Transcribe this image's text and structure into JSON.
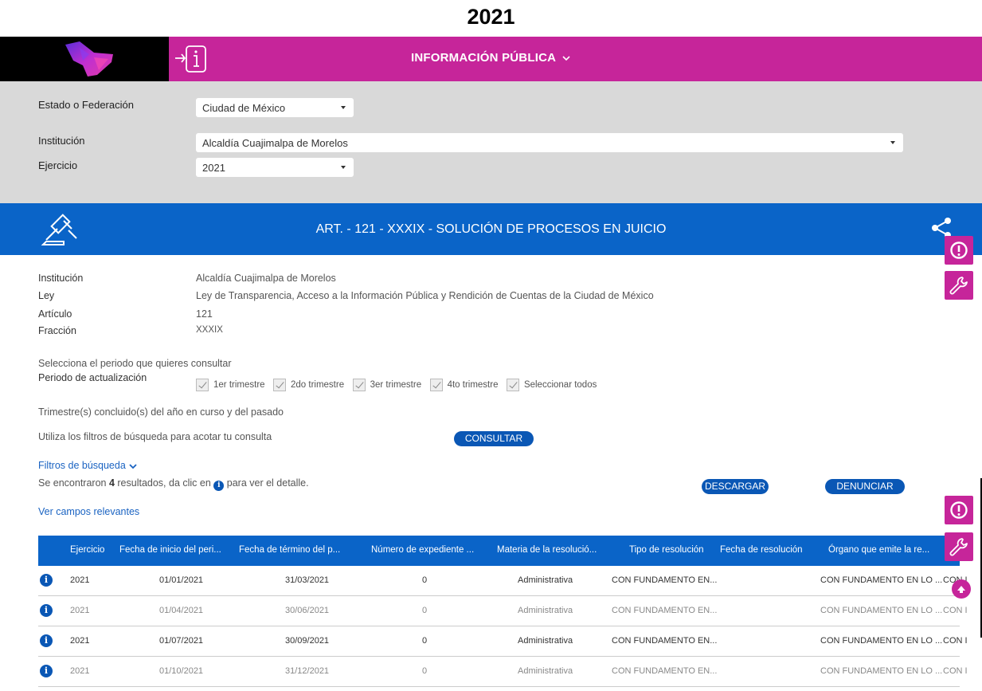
{
  "year_heading": "2021",
  "topbar": {
    "title": "INFORMACIÓN PÚBLICA",
    "colors": {
      "magenta": "#c6259a",
      "black": "#000000"
    }
  },
  "filters": {
    "estado_label": "Estado o Federación",
    "estado_value": "Ciudad de México",
    "institucion_label": "Institución",
    "institucion_value": "Alcaldía Cuajimalpa de Morelos",
    "ejercicio_label": "Ejercicio",
    "ejercicio_value": "2021"
  },
  "banner": {
    "title": "ART. - 121 - XXXIX - SOLUCIÓN DE PROCESOS EN JUICIO",
    "color": "#0a64c8"
  },
  "meta": {
    "institucion_label": "Institución",
    "institucion_value": "Alcaldía Cuajimalpa de Morelos",
    "ley_label": "Ley",
    "ley_value": "Ley de Transparencia, Acceso a la Información Pública y Rendición de Cuentas de la Ciudad de México",
    "articulo_label": "Artículo",
    "articulo_value": "121",
    "fraccion_label": "Fracción",
    "fraccion_value": "XXXIX"
  },
  "period": {
    "prompt": "Selecciona el periodo que quieres consultar",
    "label": "Periodo de actualización",
    "options": [
      "1er trimestre",
      "2do trimestre",
      "3er trimestre",
      "4to trimestre",
      "Seleccionar todos"
    ],
    "note": "Trimestre(s) concluido(s) del año en curso y del pasado"
  },
  "search": {
    "hint": "Utiliza los filtros de búsqueda para acotar tu consulta",
    "consultar": "CONSULTAR",
    "filtros_link": "Filtros de búsqueda",
    "results_prefix": "Se encontraron ",
    "results_count": "4",
    "results_mid": " resultados, da clic en ",
    "results_suffix": " para ver el detalle.",
    "descargar": "DESCARGAR",
    "denunciar": "DENUNCIAR",
    "ver_campos": "Ver campos relevantes"
  },
  "table": {
    "headers": [
      "Ejercicio",
      "Fecha de inicio del peri...",
      "Fecha de término del p...",
      "Número de expediente ...",
      "Materia de la resolució...",
      "Tipo de resolución",
      "Fecha de resolución",
      "Órgano que emite la re..."
    ],
    "rows": [
      {
        "ejercicio": "2021",
        "inicio": "01/01/2021",
        "termino": "31/03/2021",
        "expediente": "0",
        "materia": "Administrativa",
        "tipo": "CON FUNDAMENTO EN...",
        "fecha_res": "",
        "organo": "CON FUNDAMENTO EN LO ...",
        "extra": "CON I"
      },
      {
        "ejercicio": "2021",
        "inicio": "01/04/2021",
        "termino": "30/06/2021",
        "expediente": "0",
        "materia": "Administrativa",
        "tipo": "CON FUNDAMENTO EN...",
        "fecha_res": "",
        "organo": "CON FUNDAMENTO EN LO ...",
        "extra": "CON I"
      },
      {
        "ejercicio": "2021",
        "inicio": "01/07/2021",
        "termino": "30/09/2021",
        "expediente": "0",
        "materia": "Administrativa",
        "tipo": "CON FUNDAMENTO EN...",
        "fecha_res": "",
        "organo": "CON FUNDAMENTO EN LO ...",
        "extra": "CON I"
      },
      {
        "ejercicio": "2021",
        "inicio": "01/10/2021",
        "termino": "31/12/2021",
        "expediente": "0",
        "materia": "Administrativa",
        "tipo": "CON FUNDAMENTO EN...",
        "fecha_res": "",
        "organo": "CON FUNDAMENTO EN LO ...",
        "extra": "CON I"
      }
    ]
  },
  "icons": {
    "logo": "logo-icon",
    "info": "info-arrow-icon",
    "gavel": "gavel-icon",
    "share": "share-icon",
    "alert": "alert-icon",
    "tool": "wrench-icon",
    "row_info": "info-circle-icon",
    "scroll_up": "arrow-up-icon"
  }
}
